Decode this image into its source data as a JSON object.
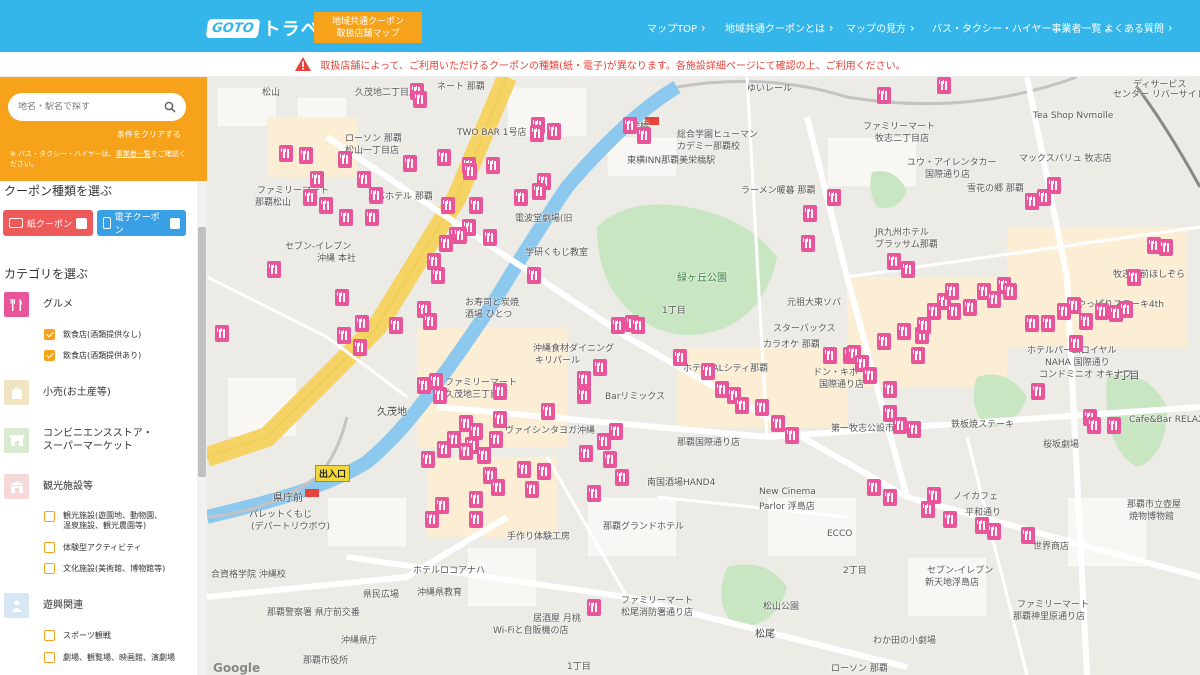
{
  "header": {
    "logo_badge": "GOTO",
    "logo_text": "トラベル",
    "map_button_line1": "地域共通クーポン",
    "map_button_line2": "取扱店舗マップ",
    "nav": [
      {
        "label": "マップTOP"
      },
      {
        "label": "地域共通クーポンとは"
      },
      {
        "label": "マップの見方"
      },
      {
        "label": "バス・タクシー・ハイヤー事業者一覧"
      },
      {
        "label": "よくある質問"
      }
    ]
  },
  "notice": {
    "text": "取扱店舗によって、ご利用いただけるクーポンの種類(紙・電子)が異なります。各施設詳細ページにて確認の上、ご利用ください。"
  },
  "sidebar": {
    "search_placeholder": "地名・駅名で探す",
    "clear_link": "条件をクリアする",
    "note_prefix": "※ バス・タクシー・ハイヤーは、",
    "note_link": "事業者一覧",
    "note_suffix": "をご確認ください。",
    "coupon_title": "クーポン種類を選ぶ",
    "coupon_paper": "紙クーポン",
    "coupon_electronic": "電子クーポン",
    "category_title": "カテゴリを選ぶ",
    "categories": [
      {
        "label": "グルメ",
        "color": "#e8559b"
      },
      {
        "label": "小売(お土産等)",
        "color": "#f1e4c3"
      },
      {
        "label": "コンビニエンスストア・",
        "label2": "スーパーマーケット",
        "color": "#d9ead0"
      },
      {
        "label": "観光施設等",
        "color": "#f6d8d8"
      },
      {
        "label": "遊興関連",
        "color": "#d6e6f5"
      }
    ],
    "sub_gourmet": [
      {
        "label": "飲食店(酒類提供なし)",
        "checked": true
      },
      {
        "label": "飲食店(酒類提供あり)",
        "checked": true
      }
    ],
    "sub_sightseeing": [
      {
        "label": "観光施設(遊園地、動物園、",
        "label2": "温泉施設、観光農園等)"
      },
      {
        "label": "体験型アクティビティ"
      },
      {
        "label": "文化施設(美術館、博物館等)"
      }
    ],
    "sub_amusement": [
      {
        "label": "スポーツ観戦"
      },
      {
        "label": "劇場、観覧場、映画館、演劇場"
      }
    ]
  },
  "map": {
    "labels": [
      {
        "text": "松山"
      },
      {
        "text": "ネート 那覇"
      },
      {
        "text": "久茂地二丁目店"
      },
      {
        "text": "TWO BAR 1号店"
      },
      {
        "text": "美栄橋"
      },
      {
        "text": "総合学園ヒューマン"
      },
      {
        "text": "カデミー那覇校"
      },
      {
        "text": "東横INN那覇美栄橋駅"
      },
      {
        "text": "ローソン 那覇"
      },
      {
        "text": "松山一丁目店"
      },
      {
        "text": "セブン-イレブン"
      },
      {
        "text": "沖縄 本社"
      },
      {
        "text": "ファミリーマート"
      },
      {
        "text": "那覇松山"
      },
      {
        "text": "ノバホテル 那覇"
      },
      {
        "text": "電波堂劇場(旧"
      },
      {
        "text": "学研くもじ教室"
      },
      {
        "text": "緑ヶ丘公園"
      },
      {
        "text": "1丁目"
      },
      {
        "text": "お寿司と炭焼"
      },
      {
        "text": "酒場 ひとつ"
      },
      {
        "text": "沖縄食材ダイニング"
      },
      {
        "text": "キリパール"
      },
      {
        "text": "久茂地"
      },
      {
        "text": "ファミリーマート"
      },
      {
        "text": "久茂地三丁目店"
      },
      {
        "text": "ヴァイシンタヨガ沖縄"
      },
      {
        "text": "Barリミックス"
      },
      {
        "text": "出入口"
      },
      {
        "text": "県庁前"
      },
      {
        "text": "パレットくもじ"
      },
      {
        "text": "(デパートリウボウ)"
      },
      {
        "text": "南国酒場HAND4"
      },
      {
        "text": "那覇グランドホテル"
      },
      {
        "text": "手作り体験工房"
      },
      {
        "text": "ホテルロコアナハ"
      },
      {
        "text": "合資格学院 沖縄校"
      },
      {
        "text": "県民広場"
      },
      {
        "text": "沖縄県教育"
      },
      {
        "text": "那覇警察署 県庁前交番"
      },
      {
        "text": "沖縄県庁"
      },
      {
        "text": "那覇市役所"
      },
      {
        "text": "居酒屋 月桃"
      },
      {
        "text": "Wi-Fiと自販機の店"
      },
      {
        "text": "ファミリーマート"
      },
      {
        "text": "松尾消防署通り店"
      },
      {
        "text": "1丁目"
      },
      {
        "text": "松山公園"
      },
      {
        "text": "松尾"
      },
      {
        "text": "2丁目"
      },
      {
        "text": "ECCO"
      },
      {
        "text": "New Cinema"
      },
      {
        "text": "Parlor 浮島店"
      },
      {
        "text": "那覇国際通り店"
      },
      {
        "text": "元祖大東ソバ"
      },
      {
        "text": "スターバックス"
      },
      {
        "text": "カラオケ 那覇"
      },
      {
        "text": "ドン・キホーテ"
      },
      {
        "text": "国際通り店"
      },
      {
        "text": "ホテルJALシティ那覇"
      },
      {
        "text": "ラーメン暖暮 那覇"
      },
      {
        "text": "JR九州ホテル"
      },
      {
        "text": "ブラッサム那覇"
      },
      {
        "text": "ユウ・アイレンタカー"
      },
      {
        "text": "国際通り店"
      },
      {
        "text": "ファミリーマート"
      },
      {
        "text": "牧志二丁目店"
      },
      {
        "text": "雪花の郷 那覇"
      },
      {
        "text": "マックスバリュ 牧志店"
      },
      {
        "text": "Tea Shop Nvmolle"
      },
      {
        "text": "ゆいレール"
      },
      {
        "text": "セブン-イレブン"
      },
      {
        "text": "新天地浮島店"
      },
      {
        "text": "ファミリーマート"
      },
      {
        "text": "那覇神里原通り店"
      },
      {
        "text": "桜坂劇場"
      },
      {
        "text": "那覇市立壺屋"
      },
      {
        "text": "焼物博物館"
      },
      {
        "text": "Cafe&Bar RELAX"
      },
      {
        "text": "3丁目"
      },
      {
        "text": "ホテルパームロイヤル"
      },
      {
        "text": "NAHA 国際通り"
      },
      {
        "text": "コンドミニオ オキナワ"
      },
      {
        "text": "牧志駅前ほしぞら"
      },
      {
        "text": "やっぱりステーキ4th"
      },
      {
        "text": "世界商店"
      },
      {
        "text": "ノイカフェ"
      },
      {
        "text": "平和通り"
      },
      {
        "text": "鉄板焼ステーキ"
      },
      {
        "text": "第一牧志公設市場"
      },
      {
        "text": "わか田の小劇場"
      },
      {
        "text": "ローソン 那覇"
      },
      {
        "text": "ディサービス"
      },
      {
        "text": "センター リバーサイド"
      },
      {
        "text": "Google"
      }
    ]
  }
}
